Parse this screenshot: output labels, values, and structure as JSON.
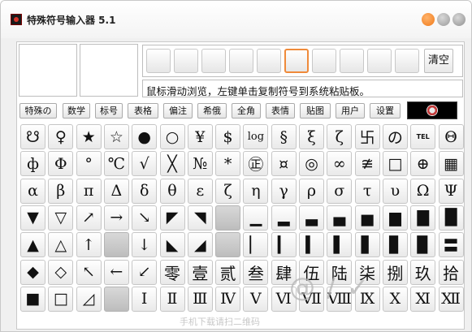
{
  "window": {
    "title": "特殊符号输入器 5.1"
  },
  "toolbar": {
    "clear_label": "清空",
    "hint": "鼠标滑动浏览，左键单击复制符号到系统粘贴板。"
  },
  "recent_slots": 10,
  "selected_slot": 5,
  "tabs": [
    {
      "label": "特殊の"
    },
    {
      "label": "数学"
    },
    {
      "label": "标号"
    },
    {
      "label": "表格"
    },
    {
      "label": "偏注"
    },
    {
      "label": "希俄"
    },
    {
      "label": "全角"
    },
    {
      "label": "表情"
    },
    {
      "label": "贴图"
    },
    {
      "label": "用户"
    },
    {
      "label": "设置"
    }
  ],
  "symbols": [
    [
      "☋",
      "♀",
      "★",
      "☆",
      "●",
      "○",
      "¥",
      "$",
      "log",
      "§",
      "ξ",
      "ζ",
      "卐",
      "の",
      "TEL",
      "Θ"
    ],
    [
      "ф",
      "Φ",
      "°",
      "℃",
      "√",
      "╳",
      "№",
      "*",
      "㊣",
      "¤",
      "◎",
      "∞",
      "≇",
      "□",
      "⊕",
      "▦"
    ],
    [
      "α",
      "β",
      "π",
      "Δ",
      "δ",
      "θ",
      "ε",
      "ζ",
      "η",
      "γ",
      "ρ",
      "σ",
      "τ",
      "υ",
      "Ω",
      "Ψ"
    ],
    [
      "▼",
      "▽",
      "↗",
      "→",
      "↘",
      "◤",
      "◥",
      "",
      "▁",
      "▂",
      "▃",
      "▄",
      "▅",
      "▆",
      "▇",
      "█"
    ],
    [
      "▲",
      "△",
      "↑",
      "",
      "↓",
      "◣",
      "◢",
      "",
      "▏",
      "▎",
      "▍",
      "▌",
      "▋",
      "▊",
      "▉",
      "〓"
    ],
    [
      "◆",
      "◇",
      "↖",
      "←",
      "↙",
      "零",
      "壹",
      "贰",
      "叁",
      "肆",
      "伍",
      "陆",
      "柒",
      "捌",
      "玖",
      "拾"
    ],
    [
      "■",
      "□",
      "◿",
      "",
      "Ⅰ",
      "Ⅱ",
      "Ⅲ",
      "Ⅳ",
      "Ⅴ",
      "Ⅵ",
      "Ⅶ",
      "Ⅷ",
      "Ⅸ",
      "Ⅹ",
      "Ⅺ",
      "Ⅻ"
    ]
  ],
  "watermark": {
    "big": "@ /  ✓",
    "small": "手机下载请扫二维码"
  }
}
